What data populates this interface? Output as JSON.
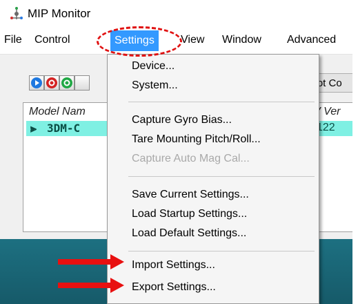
{
  "window": {
    "title": "MIP Monitor"
  },
  "menubar": {
    "items": [
      {
        "label": "File"
      },
      {
        "label": "Control"
      },
      {
        "label": "Settings"
      },
      {
        "label": "View"
      },
      {
        "label": "Window"
      },
      {
        "label": "Advanced"
      }
    ]
  },
  "toolbar": {
    "buttons": [
      {
        "icon": "play-icon",
        "color": "#1e78e0"
      },
      {
        "icon": "stop-icon",
        "color": "#d42222"
      },
      {
        "icon": "record-icon",
        "color": "#1fa844"
      }
    ],
    "status_text": "Not Co"
  },
  "device_list": {
    "columns": [
      "Model Nam",
      "V Ver"
    ],
    "rows": [
      {
        "model": "3DM-C",
        "version": "122"
      }
    ]
  },
  "settings_menu": {
    "items": [
      {
        "label": "Device...",
        "enabled": true
      },
      {
        "label": "System...",
        "enabled": true
      },
      {
        "label": "Capture Gyro Bias...",
        "enabled": true
      },
      {
        "label": "Tare Mounting Pitch/Roll...",
        "enabled": true
      },
      {
        "label": "Capture Auto Mag Cal...",
        "enabled": false
      },
      {
        "label": "Save Current Settings...",
        "enabled": true
      },
      {
        "label": "Load Startup Settings...",
        "enabled": true
      },
      {
        "label": "Load Default Settings...",
        "enabled": true
      },
      {
        "label": "Import Settings...",
        "enabled": true
      },
      {
        "label": "Export Settings...",
        "enabled": true
      }
    ]
  },
  "annotations": {
    "highlight_color": "#e01212",
    "arrow_color": "#e81010"
  }
}
